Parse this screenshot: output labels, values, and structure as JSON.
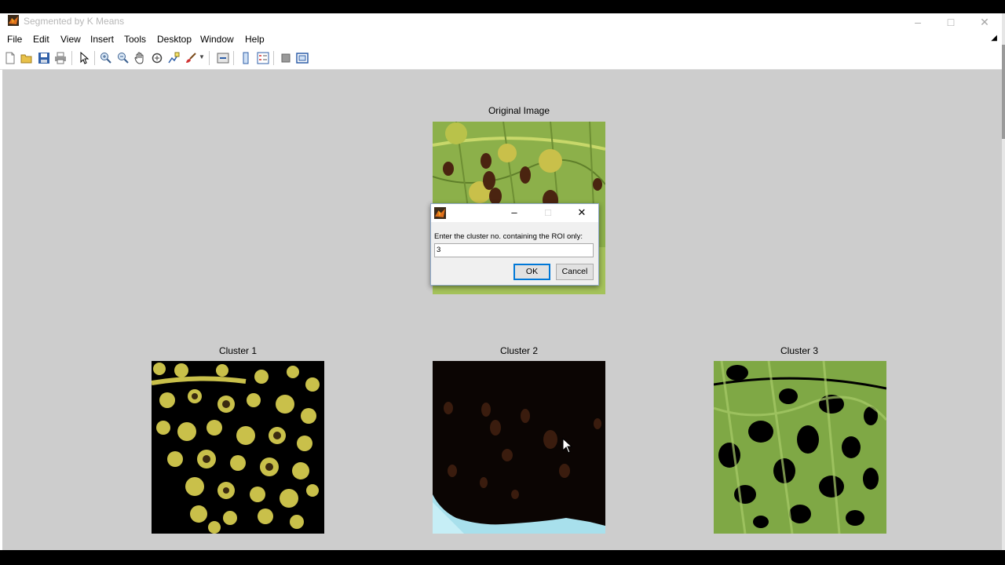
{
  "window": {
    "title": "Segmented by K Means",
    "controls": {
      "minimize": "–",
      "maximize": "□",
      "close": "✕"
    }
  },
  "menu": [
    "File",
    "Edit",
    "View",
    "Insert",
    "Tools",
    "Desktop",
    "Window",
    "Help"
  ],
  "toolbar": {
    "icons": [
      "new-figure-icon",
      "open-file-icon",
      "save-icon",
      "print-icon",
      "edit-plot-icon",
      "zoom-in-icon",
      "zoom-out-icon",
      "pan-icon",
      "rotate-3d-icon",
      "data-cursor-icon",
      "brush-icon",
      "link-plot-icon",
      "colorbar-icon",
      "legend-icon",
      "hide-plot-tools-icon",
      "show-plot-tools-icon"
    ]
  },
  "axes": {
    "original": {
      "title": "Original Image"
    },
    "cluster1": {
      "title": "Cluster 1"
    },
    "cluster2": {
      "title": "Cluster 2"
    },
    "cluster3": {
      "title": "Cluster 3"
    }
  },
  "dialog": {
    "controls": {
      "minimize": "–",
      "maximize": "□",
      "close": "✕"
    },
    "prompt": "Enter the cluster no. containing the ROI only:",
    "input_value": "3",
    "ok_label": "OK",
    "cancel_label": "Cancel"
  },
  "colors": {
    "canvas_bg": "#cdcdcd",
    "leaf_green": "#8cb04a",
    "spot_brown": "#4a2410",
    "yellow_lesion": "#c9c04a",
    "cluster2_cyan": "#a8e0ec",
    "dialog_focus": "#0078d7"
  }
}
